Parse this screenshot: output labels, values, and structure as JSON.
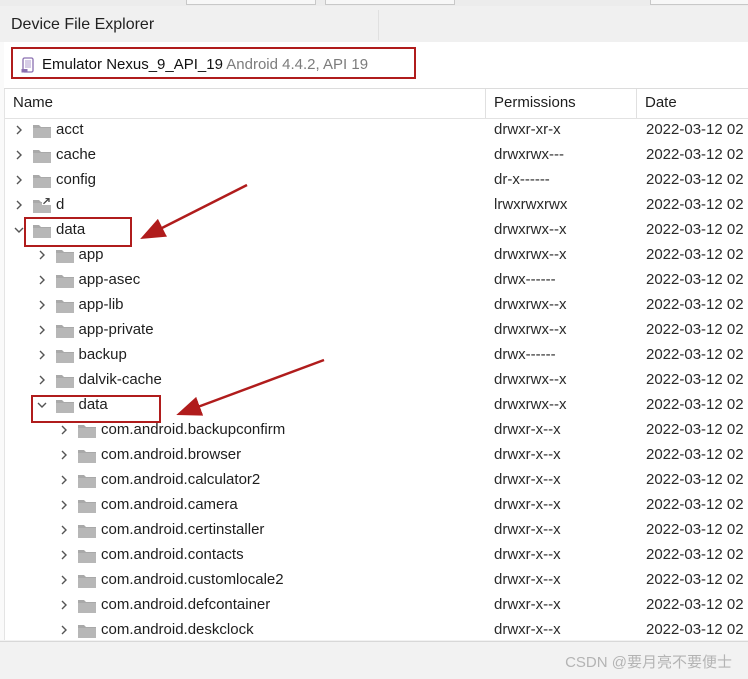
{
  "panel": {
    "title": "Device File Explorer"
  },
  "device": {
    "name": "Emulator Nexus_9_API_19",
    "detail": "Android 4.4.2, API 19"
  },
  "columns": {
    "name": "Name",
    "permissions": "Permissions",
    "date": "Date"
  },
  "rows": [
    {
      "name": "acct",
      "permissions": "drwxr-xr-x",
      "date": "2022-03-12 02",
      "depth": 0,
      "expanded": false,
      "link": false
    },
    {
      "name": "cache",
      "permissions": "drwxrwx---",
      "date": "2022-03-12 02",
      "depth": 0,
      "expanded": false,
      "link": false
    },
    {
      "name": "config",
      "permissions": "dr-x------",
      "date": "2022-03-12 02",
      "depth": 0,
      "expanded": false,
      "link": false
    },
    {
      "name": "d",
      "permissions": "lrwxrwxrwx",
      "date": "2022-03-12 02",
      "depth": 0,
      "expanded": false,
      "link": true
    },
    {
      "name": "data",
      "permissions": "drwxrwx--x",
      "date": "2022-03-12 02",
      "depth": 0,
      "expanded": true,
      "link": false
    },
    {
      "name": "app",
      "permissions": "drwxrwx--x",
      "date": "2022-03-12 02",
      "depth": 1,
      "expanded": false,
      "link": false
    },
    {
      "name": "app-asec",
      "permissions": "drwx------",
      "date": "2022-03-12 02",
      "depth": 1,
      "expanded": false,
      "link": false
    },
    {
      "name": "app-lib",
      "permissions": "drwxrwx--x",
      "date": "2022-03-12 02",
      "depth": 1,
      "expanded": false,
      "link": false
    },
    {
      "name": "app-private",
      "permissions": "drwxrwx--x",
      "date": "2022-03-12 02",
      "depth": 1,
      "expanded": false,
      "link": false
    },
    {
      "name": "backup",
      "permissions": "drwx------",
      "date": "2022-03-12 02",
      "depth": 1,
      "expanded": false,
      "link": false
    },
    {
      "name": "dalvik-cache",
      "permissions": "drwxrwx--x",
      "date": "2022-03-12 02",
      "depth": 1,
      "expanded": false,
      "link": false
    },
    {
      "name": "data",
      "permissions": "drwxrwx--x",
      "date": "2022-03-12 02",
      "depth": 1,
      "expanded": true,
      "link": false
    },
    {
      "name": "com.android.backupconfirm",
      "permissions": "drwxr-x--x",
      "date": "2022-03-12 02",
      "depth": 2,
      "expanded": false,
      "link": false
    },
    {
      "name": "com.android.browser",
      "permissions": "drwxr-x--x",
      "date": "2022-03-12 02",
      "depth": 2,
      "expanded": false,
      "link": false
    },
    {
      "name": "com.android.calculator2",
      "permissions": "drwxr-x--x",
      "date": "2022-03-12 02",
      "depth": 2,
      "expanded": false,
      "link": false
    },
    {
      "name": "com.android.camera",
      "permissions": "drwxr-x--x",
      "date": "2022-03-12 02",
      "depth": 2,
      "expanded": false,
      "link": false
    },
    {
      "name": "com.android.certinstaller",
      "permissions": "drwxr-x--x",
      "date": "2022-03-12 02",
      "depth": 2,
      "expanded": false,
      "link": false
    },
    {
      "name": "com.android.contacts",
      "permissions": "drwxr-x--x",
      "date": "2022-03-12 02",
      "depth": 2,
      "expanded": false,
      "link": false
    },
    {
      "name": "com.android.customlocale2",
      "permissions": "drwxr-x--x",
      "date": "2022-03-12 02",
      "depth": 2,
      "expanded": false,
      "link": false
    },
    {
      "name": "com.android.defcontainer",
      "permissions": "drwxr-x--x",
      "date": "2022-03-12 02",
      "depth": 2,
      "expanded": false,
      "link": false
    },
    {
      "name": "com.android.deskclock",
      "permissions": "drwxr-x--x",
      "date": "2022-03-12 02",
      "depth": 2,
      "expanded": false,
      "link": false
    }
  ],
  "watermark": "CSDN @要月亮不要便士",
  "colors": {
    "annotation": "#b01c1c",
    "folder": "#a9a9a9",
    "text": "#1e1e1e",
    "dim_text": "#7c7c7c"
  }
}
